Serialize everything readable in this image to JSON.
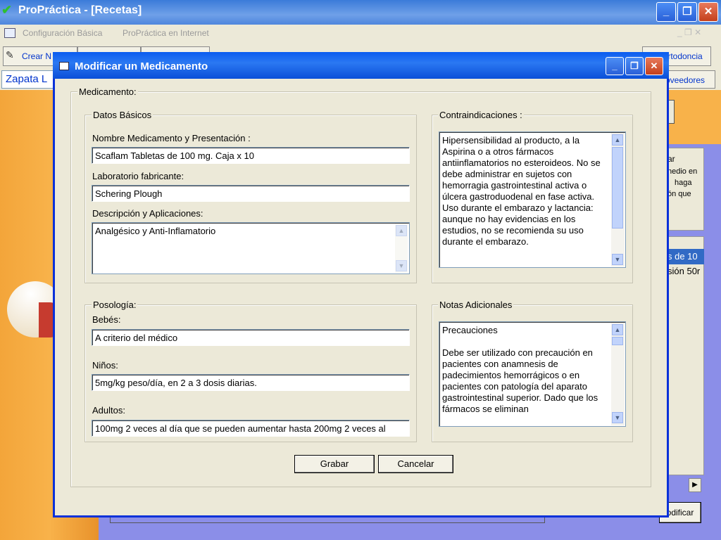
{
  "window": {
    "title": "ProPráctica - [Recetas]"
  },
  "menu": [
    "Configuración Básica",
    "ProPráctica en Internet"
  ],
  "toolbar": {
    "crear_label": "Crear N",
    "ortodoncia_label": "Ortodoncia",
    "proveedores_label": "oveedores"
  },
  "patient_field": "Zapata L",
  "background": {
    "snippet_1": "ar",
    "snippet_2": "nedio en",
    "snippet_3": "haga",
    "snippet_4": "ón que",
    "list_item_1": "s de 10",
    "list_item_2": "sión 50r",
    "modificar_label": "odificar"
  },
  "dialog": {
    "title": "Modificar un Medicamento",
    "group_medicamento": "Medicamento:",
    "group_datos": "Datos Básicos",
    "nombre_label": "Nombre Medicamento y  Presentación :",
    "nombre_value": "Scaflam Tabletas de 100 mg. Caja x 10",
    "laboratorio_label": "Laboratorio fabricante:",
    "laboratorio_value": "Schering Plough",
    "descripcion_label": "Descripción y Aplicaciones:",
    "descripcion_value": "Analgésico y Anti-Inflamatorio",
    "group_contra": "Contraindicaciones :",
    "contra_value": "Hipersensibilidad al producto, a la Aspirina o a otros fármacos antiinflamatorios no esteroideos.  No se debe administrar en sujetos con hemorragia gastrointestinal activa o úlcera gastroduodenal en fase activa. Uso durante el embarazo y lactancia: aunque no hay evidencias en los estudios, no se recomienda su uso durante el embarazo.",
    "group_posologia": "Posología:",
    "bebes_label": "Bebés:",
    "bebes_value": "A criterio del médico",
    "ninos_label": "Niños:",
    "ninos_value": "5mg/kg peso/día, en 2 a 3 dosis diarias.",
    "adultos_label": "Adultos:",
    "adultos_value": "100mg 2 veces al día que se pueden aumentar hasta 200mg 2 veces al",
    "group_notas": "Notas Adicionales",
    "notas_title": "Precauciones",
    "notas_body": "Debe ser utilizado con precaución en pacientes con anamnesis de padecimientos hemorrágicos o en pacientes con patología del aparato gastrointestinal superior.  Dado que los fármacos se eliminan",
    "grabar_label": "Grabar",
    "cancelar_label": "Cancelar"
  },
  "colors": {
    "titlebar": "#0a5cf0",
    "dialog_bg": "#ece9d8",
    "accent_orange": "#f8b24a",
    "panel_blue": "#8b8ee8"
  }
}
